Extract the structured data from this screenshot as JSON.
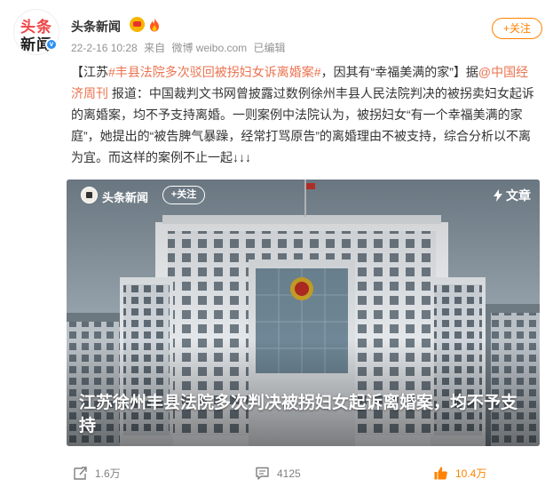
{
  "post": {
    "author": "头条新闻",
    "avatar_line1": "头条",
    "avatar_line2": "新闻",
    "verified_mark": "v",
    "time": "22-2-16 10:28",
    "source_prefix": "来自",
    "source": "微博 weibo.com",
    "edited": "已编辑",
    "follow_label": "+关注",
    "text": {
      "bracket_open": "【江苏",
      "topic": "#丰县法院多次驳回被拐妇女诉离婚案#",
      "bracket_rest": "，因其有“幸福美满的家”】据",
      "mention": "@中国经济周刊",
      "body": " 报道：中国裁判文书网曾披露过数例徐州丰县人民法院判决的被拐卖妇女起诉的离婚案，均不予支持离婚。一则案例中法院认为，被拐妇女“有一个幸福美满的家庭”，她提出的“被告脾气暴躁，经常打骂原告”的离婚理由不被支持，综合分析以不离为宜。而这样的案例不止一起↓↓↓"
    }
  },
  "card": {
    "author": "头条新闻",
    "follow_label": "+关注",
    "article_label": "文章",
    "title": "江苏徐州丰县法院多次判决被拐妇女起诉离婚案，均不予支持"
  },
  "footer": {
    "repost_count": "1.6万",
    "comment_count": "4125",
    "like_count": "10.4万"
  },
  "colors": {
    "accent": "#ff8200",
    "link": "#eb7350",
    "meta": "#939393"
  }
}
